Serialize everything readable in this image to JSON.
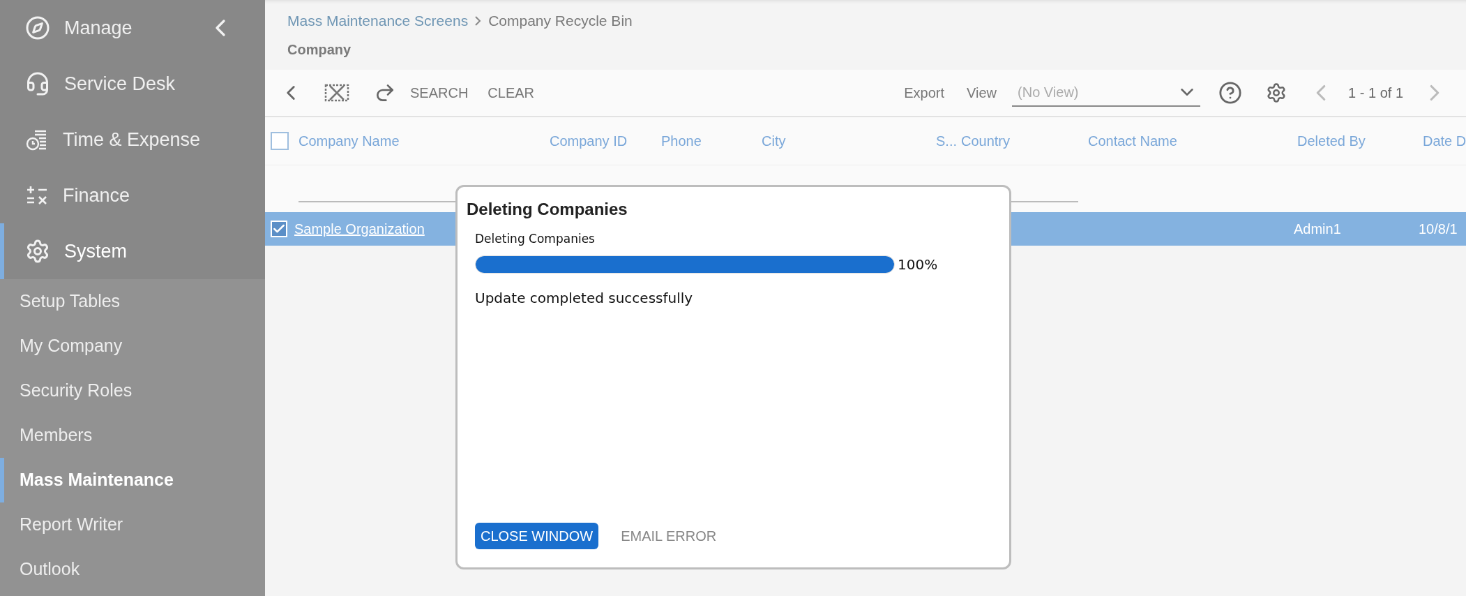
{
  "sidebar": {
    "modules": [
      {
        "label": "Manage",
        "selected": false
      },
      {
        "label": "Service Desk",
        "selected": false
      },
      {
        "label": "Time & Expense",
        "selected": false
      },
      {
        "label": "Finance",
        "selected": false
      },
      {
        "label": "System",
        "selected": true
      }
    ],
    "items": [
      {
        "label": "Setup Tables",
        "selected": false
      },
      {
        "label": "My Company",
        "selected": false
      },
      {
        "label": "Security Roles",
        "selected": false
      },
      {
        "label": "Members",
        "selected": false
      },
      {
        "label": "Mass Maintenance",
        "selected": true
      },
      {
        "label": "Report Writer",
        "selected": false
      },
      {
        "label": "Outlook",
        "selected": false
      }
    ]
  },
  "breadcrumb": [
    "Mass Maintenance Screens",
    "Company Recycle Bin"
  ],
  "page_title": "Company",
  "toolbar": {
    "buttons": [
      "SEARCH",
      "CLEAR"
    ],
    "export": "Export",
    "view_label": "View",
    "view_select": {
      "placeholder": "(No View)"
    },
    "pager": "1 - 1 of 1"
  },
  "table": {
    "all_checked": false,
    "columns": [
      "Company Name",
      "Company ID",
      "Phone",
      "City",
      "S...",
      "Country",
      "Contact Name",
      "Deleted By",
      "Date D"
    ],
    "rows": [
      {
        "checked": true,
        "selected": true,
        "company_name": "Sample Organization",
        "deleted_by": "Admin1",
        "column_9": "10/8/1"
      }
    ]
  },
  "dialog": {
    "title": "Deleting Companies",
    "task": "Deleting Companies",
    "level": 1,
    "percent": "100%",
    "status": "Update completed successfully",
    "buttons": [
      {
        "label": "CLOSE WINDOW",
        "kind": "primary"
      },
      {
        "label": "EMAIL ERROR",
        "kind": "text"
      }
    ]
  }
}
